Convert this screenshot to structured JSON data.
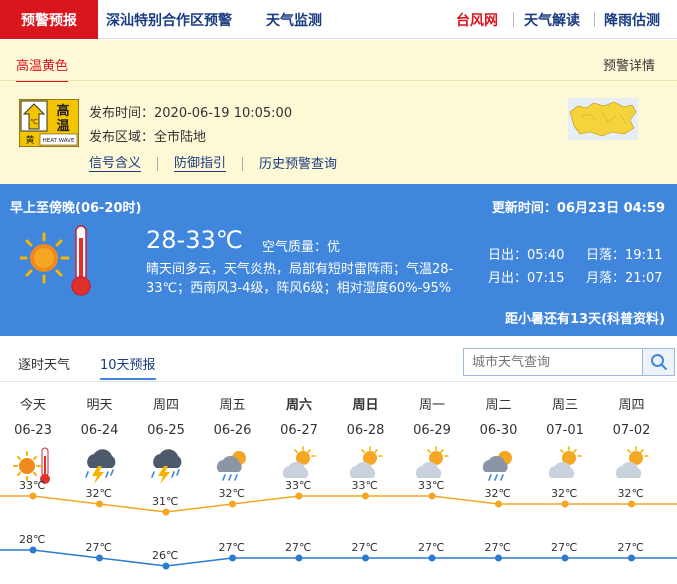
{
  "nav": {
    "active": "预警预报",
    "links": [
      "深汕特别合作区预警",
      "天气监测"
    ],
    "right_links": [
      "台风网",
      "天气解读",
      "降雨估测"
    ]
  },
  "warning": {
    "tab": "高温黄色",
    "detail_link": "预警详情",
    "icon_text_top": "高",
    "icon_text_bottom": "温",
    "icon_level": "黄",
    "icon_sub": "HEAT WAVE",
    "icon_unit": "℃",
    "issue_time_label": "发布时间：",
    "issue_time": "2020-06-19 10:05:00",
    "area_label": "发布区域：",
    "area": "全市陆地",
    "links": [
      "信号含义",
      "防御指引",
      "历史预警查询"
    ]
  },
  "today": {
    "period": "早上至傍晚(06-20时)",
    "update_label": "更新时间：",
    "update_time": "06月23日 04:59",
    "temp": "28-33℃",
    "air_label": "空气质量：",
    "air_value": "优",
    "desc": "晴天间多云，天气炎热，局部有短时雷阵雨；气温28-33℃；西南风3-4级，阵风6级；相对湿度60%-95%",
    "sunrise_label": "日出：",
    "sunrise": "05:40",
    "sunset_label": "日落：",
    "sunset": "19:11",
    "moonrise_label": "月出：",
    "moonrise": "07:15",
    "moonset_label": "月落：",
    "moonset": "21:07",
    "solar_term": "距小暑还有13天(科普资料)"
  },
  "tabs": {
    "hourly": "逐时天气",
    "tenday": "10天预报",
    "search_placeholder": "城市天气查询"
  },
  "forecast": {
    "days": [
      {
        "weekday": "今天",
        "date": "06-23",
        "icon": "sunny-hot-icon",
        "bold": false
      },
      {
        "weekday": "明天",
        "date": "06-24",
        "icon": "thunderstorm-icon",
        "bold": false
      },
      {
        "weekday": "周四",
        "date": "06-25",
        "icon": "thunderstorm-icon",
        "bold": false
      },
      {
        "weekday": "周五",
        "date": "06-26",
        "icon": "cloudy-shower-icon",
        "bold": false
      },
      {
        "weekday": "周六",
        "date": "06-27",
        "icon": "partly-cloudy-icon",
        "bold": true
      },
      {
        "weekday": "周日",
        "date": "06-28",
        "icon": "partly-cloudy-icon",
        "bold": true
      },
      {
        "weekday": "周一",
        "date": "06-29",
        "icon": "partly-cloudy-icon",
        "bold": false
      },
      {
        "weekday": "周二",
        "date": "06-30",
        "icon": "cloudy-shower-icon",
        "bold": false
      },
      {
        "weekday": "周三",
        "date": "07-01",
        "icon": "partly-cloudy-icon",
        "bold": false
      },
      {
        "weekday": "周四",
        "date": "07-02",
        "icon": "partly-cloudy-icon",
        "bold": false
      }
    ],
    "high": [
      33,
      32,
      31,
      32,
      33,
      33,
      33,
      32,
      32,
      32
    ],
    "low": [
      28,
      27,
      26,
      27,
      27,
      27,
      27,
      27,
      27,
      27
    ],
    "unit": "℃",
    "colors": {
      "high": "#f5a623",
      "low": "#2b7bd1"
    }
  },
  "colors": {
    "brand_red": "#d9151e",
    "blue_panel": "#3f86dc",
    "warn_bg": "#fdf8d6",
    "link": "#1a3c82"
  }
}
